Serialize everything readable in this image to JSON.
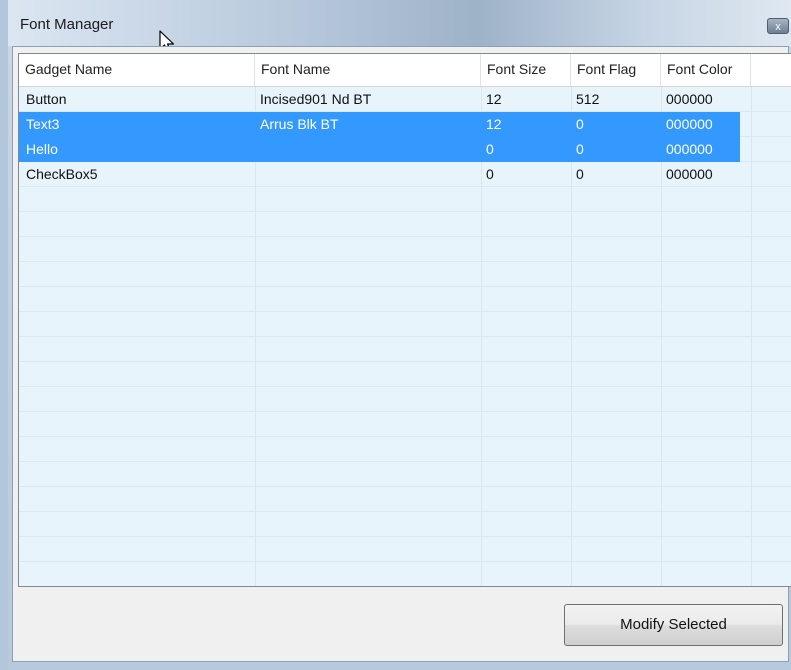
{
  "window": {
    "title": "Font Manager",
    "close_label": "x"
  },
  "grid": {
    "columns": [
      "Gadget Name",
      "Font Name",
      "Font Size",
      "Font Flag",
      "Font Color"
    ],
    "rows": [
      {
        "gadget": "Button",
        "font": "Incised901 Nd BT",
        "size": "12",
        "flag": "512",
        "color": "000000",
        "selected": false
      },
      {
        "gadget": "Text3",
        "font": "Arrus Blk BT",
        "size": "12",
        "flag": "0",
        "color": "000000",
        "selected": true
      },
      {
        "gadget": "Hello",
        "font": "",
        "size": "0",
        "flag": "0",
        "color": "000000",
        "selected": true
      },
      {
        "gadget": "CheckBox5",
        "font": "",
        "size": "0",
        "flag": "0",
        "color": "000000",
        "selected": false
      }
    ]
  },
  "footer": {
    "modify_label": "Modify Selected"
  },
  "colors": {
    "selection": "#3399ff",
    "grid_background": "#e8f4fc"
  }
}
